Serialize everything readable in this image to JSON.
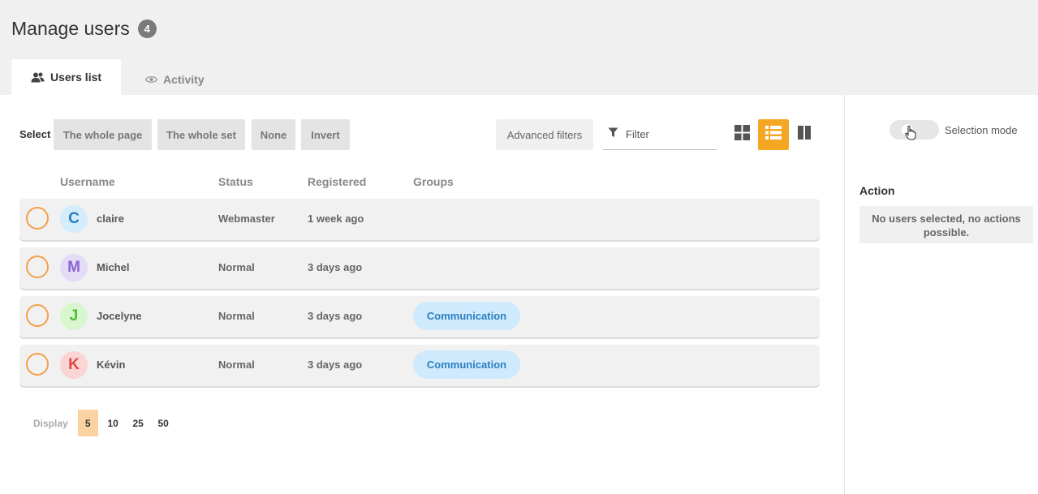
{
  "header": {
    "title": "Manage users",
    "count": "4"
  },
  "tabs": [
    {
      "label": "Users list",
      "icon": "users-icon",
      "active": true
    },
    {
      "label": "Activity",
      "icon": "eye-icon",
      "active": false
    }
  ],
  "toolbar": {
    "select_label": "Select",
    "select_buttons": [
      "The whole page",
      "The whole set",
      "None",
      "Invert"
    ],
    "advanced_filters": "Advanced filters",
    "filter_placeholder": "Filter",
    "views": [
      "grid-view-icon",
      "list-view-icon",
      "columns-view-icon"
    ],
    "active_view": "list",
    "accent_color": "#f5a623"
  },
  "table": {
    "columns": [
      "Username",
      "Status",
      "Registered",
      "Groups"
    ],
    "rows": [
      {
        "initial": "C",
        "username": "claire",
        "status": "Webmaster",
        "registered": "1 week ago",
        "group": "",
        "avatar_bg": "#d4ecfb",
        "avatar_fg": "#2a7fc0"
      },
      {
        "initial": "M",
        "username": "Michel",
        "status": "Normal",
        "registered": "3 days ago",
        "group": "",
        "avatar_bg": "#e4dcf7",
        "avatar_fg": "#8a63d2"
      },
      {
        "initial": "J",
        "username": "Jocelyne",
        "status": "Normal",
        "registered": "3 days ago",
        "group": "Communication",
        "avatar_bg": "#d8f6cf",
        "avatar_fg": "#4fbf2f"
      },
      {
        "initial": "K",
        "username": "Kévin",
        "status": "Normal",
        "registered": "3 days ago",
        "group": "Communication",
        "avatar_bg": "#fbd4d4",
        "avatar_fg": "#e04848"
      }
    ]
  },
  "pager": {
    "label": "Display",
    "options": [
      "5",
      "10",
      "25",
      "50"
    ],
    "selected": "5"
  },
  "side": {
    "selection_mode_label": "Selection mode",
    "action_title": "Action",
    "action_message": "No users selected, no actions possible."
  }
}
